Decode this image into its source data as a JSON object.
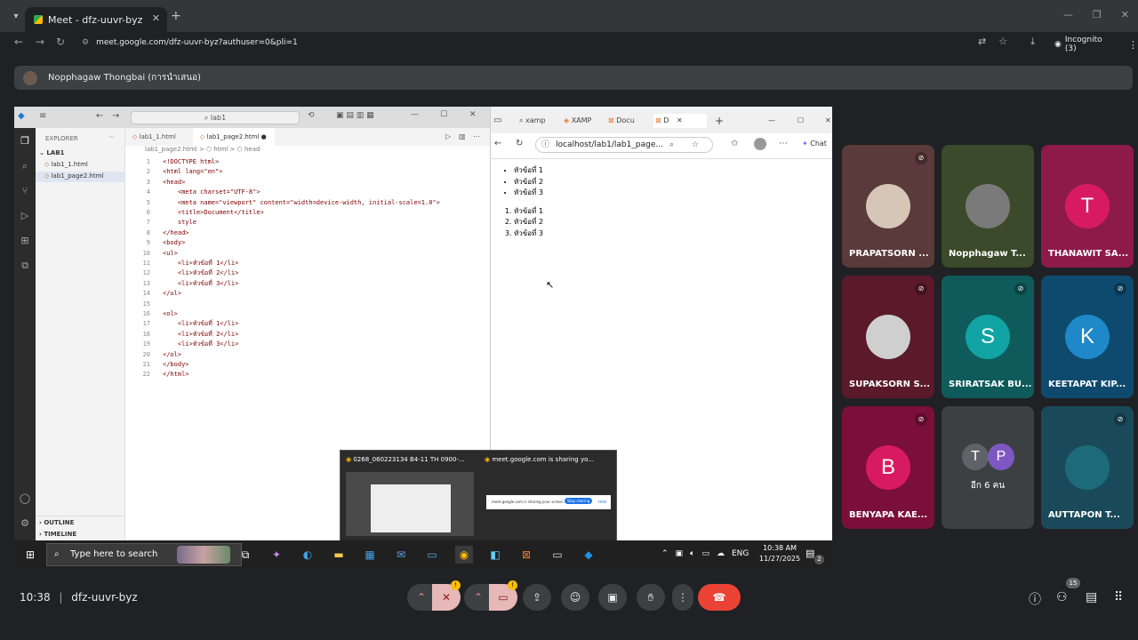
{
  "chrome": {
    "tab_title": "Meet - dfz-uuvr-byz",
    "url": "meet.google.com/dfz-uuvr-byz?authuser=0&pli=1",
    "profile": "Incognito (3)"
  },
  "meet": {
    "presenter_label": "Nopphagaw Thongbai (การนำเสนอ)",
    "meeting_time": "10:38",
    "meeting_code": "dfz-uuvr-byz",
    "people_count": "15",
    "overflow_label": "อีก 6 คน",
    "overflow_initials": [
      "T",
      "P"
    ],
    "participants": [
      {
        "name": "PRAPATSORN ...",
        "initial": "",
        "color": "#5a3a3a",
        "muted": true
      },
      {
        "name": "Nopphagaw T...",
        "initial": "",
        "color": "#3a4a2a",
        "muted": false
      },
      {
        "name": "THANAWIT SA...",
        "initial": "T",
        "color": "#8e1a4a",
        "muted": false
      },
      {
        "name": "SUPAKSORN S...",
        "initial": "",
        "color": "#5a1a2a",
        "muted": true
      },
      {
        "name": "SRIRATSAK BU...",
        "initial": "S",
        "color": "#0f5b5b",
        "muted": true
      },
      {
        "name": "KEETAPAT KIP...",
        "initial": "K",
        "color": "#0d4a6e",
        "muted": true
      },
      {
        "name": "BENYAPA KAE...",
        "initial": "B",
        "color": "#7a0f3a",
        "muted": true
      },
      {
        "name": "AUTTAPON T...",
        "initial": "",
        "color": "#1a4a5a",
        "muted": true
      }
    ]
  },
  "vscode": {
    "search": "lab1",
    "explorer_title": "EXPLORER",
    "folder": "LAB1",
    "files": [
      "lab1_1.html",
      "lab1_page2.html"
    ],
    "tabs": [
      "lab1_1.html",
      "lab1_page2.html"
    ],
    "breadcrumb": "lab1_page2.html > ⬡ html > ⬡ head",
    "outline": "OUTLINE",
    "timeline": "TIMELINE",
    "code": [
      "<!DOCTYPE html>",
      "<html lang=\"en\">",
      "<head>",
      "    <meta charset=\"UTF-8\">",
      "    <meta name=\"viewport\" content=\"width=device-width, initial-scale=1.0\">",
      "    <title>Document</title>",
      "    style",
      "</head>",
      "<body>",
      "<ul>",
      "    <li>หัวข้อที่ 1</li>",
      "    <li>หัวข้อที่ 2</li>",
      "    <li>หัวข้อที่ 3</li>",
      "</ul>",
      "",
      "<ol>",
      "    <li>หัวข้อที่ 1</li>",
      "    <li>หัวข้อที่ 2</li>",
      "    <li>หัวข้อที่ 3</li>",
      "</ol>",
      "</body>",
      "</html>"
    ]
  },
  "edge": {
    "tabs": [
      "xamp",
      "XAMP",
      "Docu",
      "D"
    ],
    "address": "localhost/lab1/lab1_page...",
    "chat": "Chat",
    "ul_items": [
      "หัวข้อที่ 1",
      "หัวข้อที่ 2",
      "หัวข้อที่ 3"
    ],
    "ol_items": [
      "หัวข้อที่ 1",
      "หัวข้อที่ 2",
      "หัวข้อที่ 3"
    ]
  },
  "thumbs": {
    "left_title": "0268_060223134 B4-11 TH 0900-...",
    "right_title": "meet.google.com is sharing yo...",
    "share_text": "meet.google.com is sharing your screen.",
    "stop_sharing": "Stop sharing",
    "hide": "Hide"
  },
  "taskbar": {
    "search": "Type here to search",
    "lang": "ENG",
    "time": "10:38 AM",
    "date": "11/27/2025",
    "notif": "2"
  }
}
